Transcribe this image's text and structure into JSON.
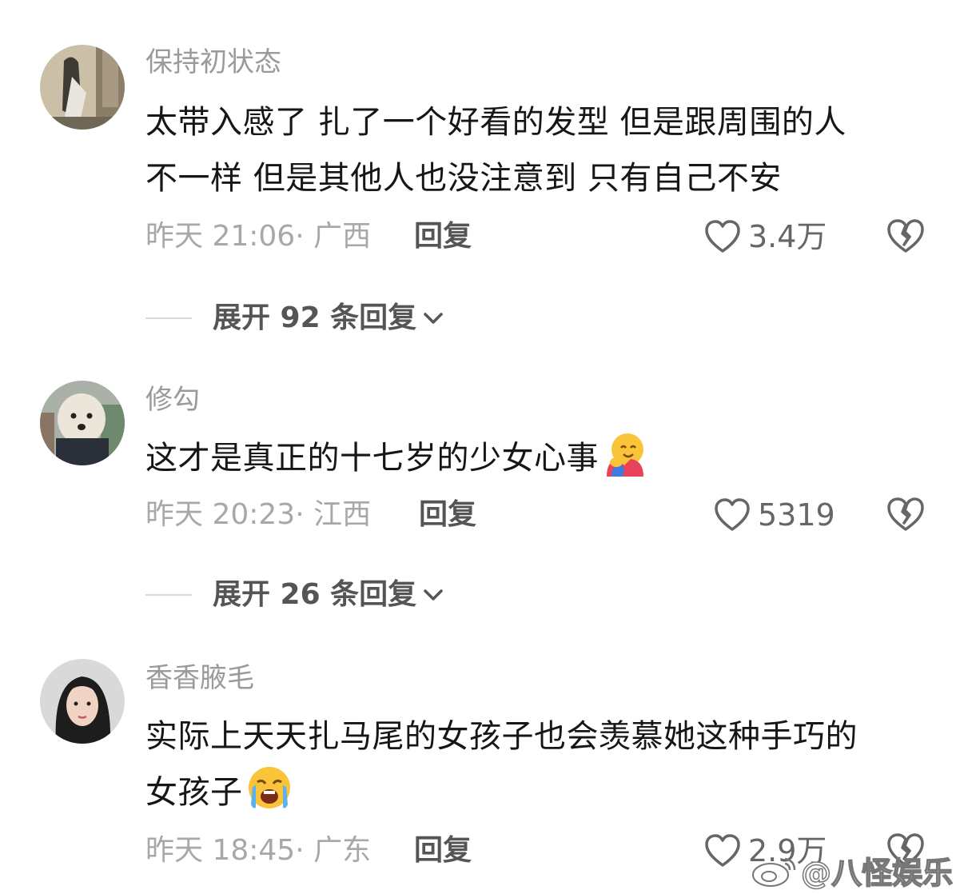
{
  "comments": [
    {
      "username": "保持初状态",
      "line1": "太带入感了 扎了一个好看的发型 但是跟周围的人",
      "line2": "不一样 但是其他人也没注意到 只有自己不安",
      "meta": "昨天 21:06· 广西",
      "reply_label": "回复",
      "likes": "3.4万",
      "expand_label": "展开 92 条回复"
    },
    {
      "username": "修勾",
      "line1": "这才是真正的十七岁的少女心事",
      "emoji": "hugging-face",
      "meta": "昨天 20:23· 江西",
      "reply_label": "回复",
      "likes": "5319",
      "expand_label": "展开 26 条回复"
    },
    {
      "username": "香香腋毛",
      "line1": "实际上天天扎马尾的女孩子也会羡慕她这种手巧的",
      "line2": "女孩子",
      "emoji": "loudly-crying-face",
      "meta": "昨天 18:45· 广东",
      "reply_label": "回复",
      "likes": "2.9万"
    }
  ],
  "watermark": "@八怪娱乐",
  "icons": {
    "like": "heart-outline-icon",
    "dislike": "broken-heart-icon",
    "expand": "chevron-down-icon"
  },
  "colors": {
    "username": "#9a9a9a",
    "meta": "#a8a8a8",
    "text": "#161616",
    "emoji_yellow": "#f9c33a"
  }
}
